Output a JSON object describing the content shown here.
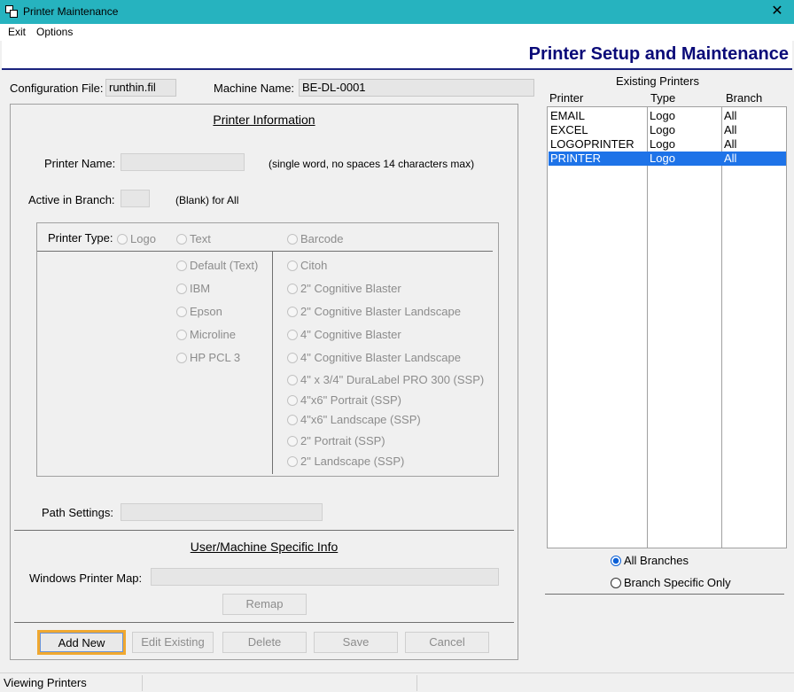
{
  "window": {
    "title": "Printer Maintenance"
  },
  "menu": {
    "items": [
      "Exit",
      "Options"
    ]
  },
  "header": {
    "title": "Printer Setup and Maintenance"
  },
  "config": {
    "config_label": "Configuration File:",
    "config_value": "runthin.fil",
    "machine_label": "Machine Name:",
    "machine_value": "BE-DL-0001"
  },
  "printer_info": {
    "title": "Printer Information",
    "name_label": "Printer Name:",
    "name_value": "",
    "name_hint": "(single word, no spaces 14 characters max)",
    "branch_label": "Active in Branch:",
    "branch_value": "",
    "branch_hint": "(Blank) for All",
    "type_label": "Printer Type:",
    "types": [
      "Logo",
      "Text",
      "Barcode"
    ],
    "text_options": [
      "Default (Text)",
      "IBM",
      "Epson",
      "Microline",
      "HP PCL 3"
    ],
    "barcode_options": [
      "Citoh",
      "2\" Cognitive Blaster",
      "2\" Cognitive Blaster Landscape",
      "4\" Cognitive Blaster",
      "4\" Cognitive Blaster Landscape",
      "4\" x 3/4\" DuraLabel PRO 300 (SSP)",
      "4\"x6\" Portrait (SSP)",
      "4\"x6\" Landscape (SSP)",
      "2\" Portrait (SSP)",
      "2\" Landscape (SSP)"
    ],
    "path_label": "Path Settings:",
    "path_value": ""
  },
  "user_info": {
    "title": "User/Machine Specific Info",
    "map_label": "Windows Printer Map:",
    "map_value": "",
    "remap_label": "Remap"
  },
  "buttons": {
    "add_new": "Add New",
    "edit_existing": "Edit Existing",
    "delete": "Delete",
    "save": "Save",
    "cancel": "Cancel"
  },
  "existing": {
    "title": "Existing Printers",
    "columns": [
      "Printer",
      "Type",
      "Branch"
    ],
    "rows": [
      {
        "printer": "EMAIL",
        "type": "Logo",
        "branch": "All"
      },
      {
        "printer": "EXCEL",
        "type": "Logo",
        "branch": "All"
      },
      {
        "printer": "LOGOPRINTER",
        "type": "Logo",
        "branch": "All"
      },
      {
        "printer": "PRINTER",
        "type": "Logo",
        "branch": "All"
      }
    ],
    "filter_all": "All Branches",
    "filter_specific": "Branch Specific Only"
  },
  "status": {
    "text": "Viewing Printers"
  }
}
